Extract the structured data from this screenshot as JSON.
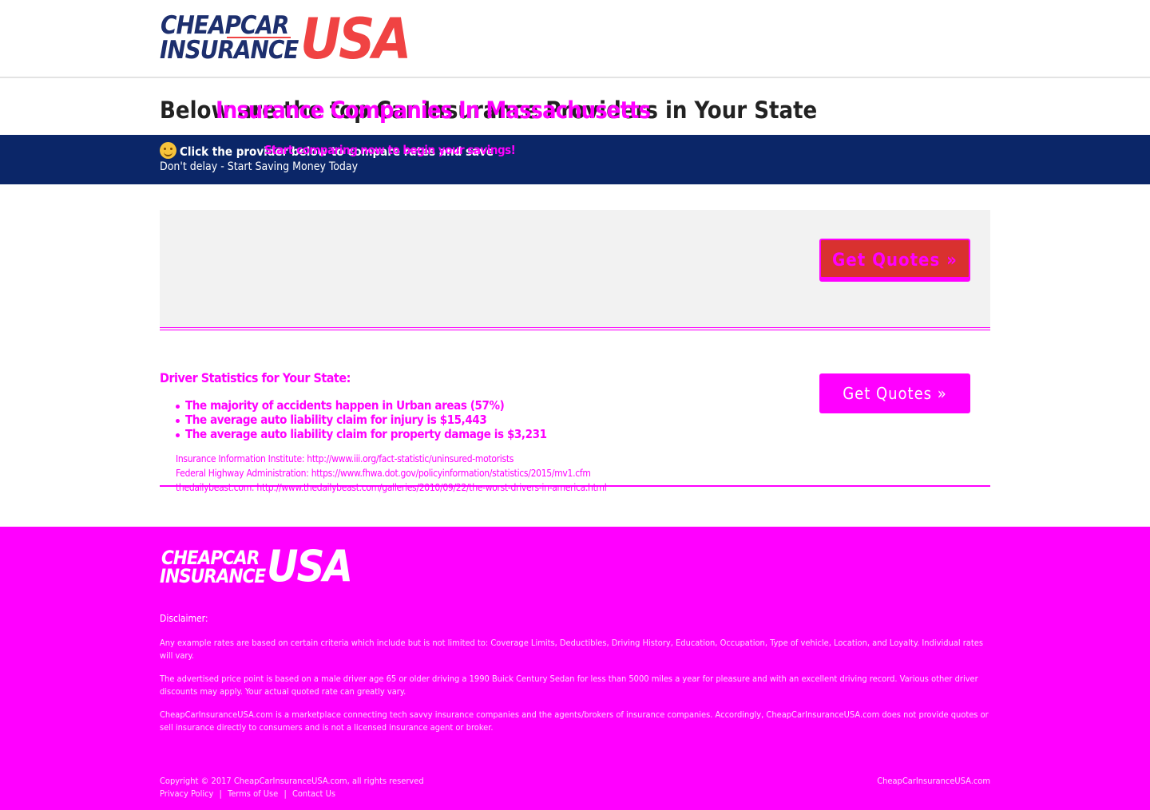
{
  "header": {
    "logo_line1": "CHEAPCAR",
    "logo_line2": "INSURANCE",
    "logo_usa": "USA"
  },
  "title": {
    "text": "Below are the top Car Insurance Providers in Your State",
    "overlay": "Insurance Companies In Massachusetts"
  },
  "banner": {
    "line1": "Click the provider below to compare rates and save",
    "line1_overlay": "Start comparing now to begin your savings!",
    "line2": "Don't delay - Start Saving Money Today"
  },
  "provider": {
    "button_label": "Get Quotes »"
  },
  "stats": {
    "title": "Driver Statistics for Your State:",
    "items": [
      "The majority of accidents happen in Urban areas (57%)",
      "The average auto liability claim for injury is $15,443",
      "The average auto liability claim for property damage is $3,231"
    ],
    "sources": [
      "Insurance Information Institute: http://www.iii.org/fact-statistic/uninsured-motorists",
      "Federal Highway Administration: https://www.fhwa.dot.gov/policyinformation/statistics/2015/mv1.cfm",
      "thedailybeast.com: http://www.thedailybeast.com/galleries/2010/09/22/the-worst-drivers-in-america.html"
    ],
    "button_label": "Get Quotes »"
  },
  "footer": {
    "logo_line1": "CHEAPCAR",
    "logo_line2": "INSURANCE",
    "logo_usa": "USA",
    "disclaimer_heading": "Disclaimer:",
    "disclaimer1": "Any example rates are based on certain criteria which include but is not limited to: Coverage Limits, Deductibles, Driving History, Education, Occupation, Type of vehicle, Location, and Loyalty. Individual rates will vary.",
    "disclaimer2": "The advertised price point is based on a male driver age 65 or older driving a 1990 Buick Century Sedan for less than 5000 miles a year for pleasure and with an excellent driving record. Various other driver discounts may apply. Your actual quoted rate can greatly vary.",
    "disclaimer3": "CheapCarInsuranceUSA.com is a marketplace connecting tech savvy insurance companies and the agents/brokers of insurance companies. Accordingly, CheapCarInsuranceUSA.com does not provide quotes or sell insurance directly to consumers and is not a licensed insurance agent or broker.",
    "copyright": "Copyright © 2017 CheapCarInsuranceUSA.com, all rights reserved",
    "links": [
      "Privacy Policy",
      "|",
      "Terms of Use",
      "|",
      "Contact Us"
    ],
    "powered": "CheapCarInsuranceUSA.com"
  }
}
